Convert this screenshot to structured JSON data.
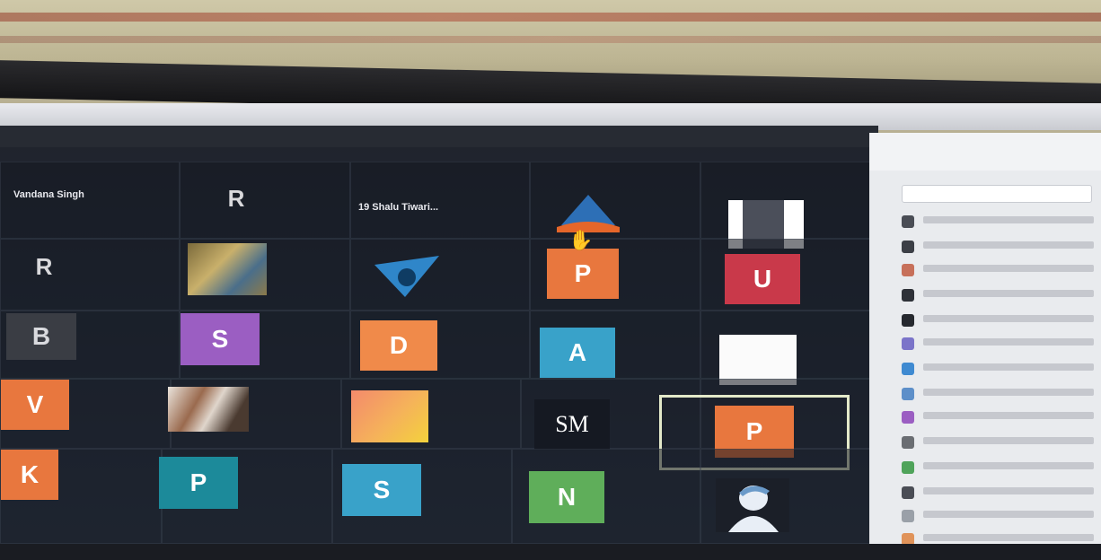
{
  "gallery": {
    "labels": {
      "tile1": "Vandana Singh",
      "tile3": "19 Shalu Tiwari..."
    },
    "avatars": {
      "r1": "R",
      "r2": "R",
      "b1": "B",
      "s1": "S",
      "d1": "D",
      "p1": "P",
      "u1": "U",
      "a1": "A",
      "sm1": "SM",
      "p2": "P",
      "p3": "P",
      "s2": "S",
      "n1": "N",
      "v1": "V",
      "k1": "K"
    }
  },
  "colors": {
    "purple": "#9b5ec2",
    "orange": "#e8773e",
    "teal": "#1c8a9a",
    "blue": "#39a2c9",
    "red": "#c9394a",
    "green": "#5fae5a",
    "dark": "#151922"
  }
}
